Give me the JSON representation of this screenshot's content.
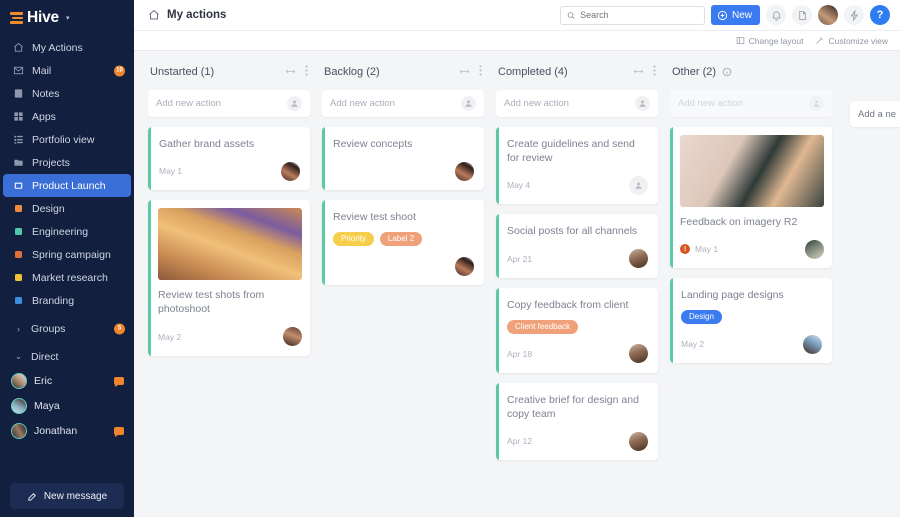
{
  "sidebar": {
    "logo": {
      "text": "Hive",
      "caret": "▾"
    },
    "nav": [
      {
        "label": "My Actions",
        "icon": "home-icon",
        "active": false
      },
      {
        "label": "Mail",
        "icon": "mail-icon",
        "active": false,
        "badge": "10"
      },
      {
        "label": "Notes",
        "icon": "notes-icon",
        "active": false
      },
      {
        "label": "Apps",
        "icon": "apps-grid-icon",
        "active": false
      },
      {
        "label": "Portfolio view",
        "icon": "list-icon",
        "active": false
      },
      {
        "label": "Projects",
        "icon": "folder-icon",
        "active": false
      },
      {
        "label": "Product Launch",
        "icon": "square-outline-icon",
        "active": true
      },
      {
        "label": "Design",
        "icon": "dot-icon",
        "dot": "#ef8a3c",
        "active": false
      },
      {
        "label": "Engineering",
        "icon": "dot-icon",
        "dot": "#52c8a9",
        "active": false
      },
      {
        "label": "Spring campaign",
        "icon": "dot-icon",
        "dot": "#e0703a",
        "active": false
      },
      {
        "label": "Market research",
        "icon": "dot-icon",
        "dot": "#f2c230",
        "active": false
      },
      {
        "label": "Branding",
        "icon": "dot-icon",
        "dot": "#3b8de0",
        "active": false
      }
    ],
    "groups": {
      "label": "Groups",
      "badge": "5",
      "chevron": "›"
    },
    "direct": {
      "label": "Direct",
      "chevron": "⌄"
    },
    "people": [
      {
        "name": "Eric",
        "unread": true
      },
      {
        "name": "Maya",
        "unread": false
      },
      {
        "name": "Jonathan",
        "unread": true
      }
    ],
    "new_message": "New message"
  },
  "topbar": {
    "title": "My actions",
    "home_icon": "home-icon",
    "search_placeholder": "Search",
    "search_value": "",
    "new_button": "New",
    "icons": [
      "bell-icon",
      "file-icon",
      "avatar",
      "lightning-icon",
      "help-icon"
    ],
    "help_glyph": "?"
  },
  "subbar": {
    "change_layout": "Change layout",
    "customize_view": "Customize view"
  },
  "board": {
    "add_column_label": "Add a ne",
    "add_new_action": "Add new action",
    "columns": [
      {
        "title": "Unstarted (1)",
        "has_info": false,
        "faded": false,
        "cards": [
          {
            "title": "Gather brand assets",
            "date": "May 1",
            "avatar": "woman-1",
            "labels": [],
            "image": null,
            "priority": false
          },
          {
            "title": "Review test shots from photoshoot",
            "date": "May 2",
            "avatar": "woman-2",
            "labels": [],
            "image": "sunglasses-pouch",
            "priority": false
          }
        ]
      },
      {
        "title": "Backlog (2)",
        "has_info": false,
        "faded": false,
        "cards": [
          {
            "title": "Review concepts",
            "date": "",
            "avatar": "woman-1",
            "labels": [],
            "image": null,
            "priority": false
          },
          {
            "title": "Review test shoot",
            "date": "",
            "avatar": "woman-1",
            "labels": [
              {
                "text": "Priority",
                "color": "#f7ce4b"
              },
              {
                "text": "Label 2",
                "color": "#f0a179"
              }
            ],
            "image": null,
            "priority": false
          }
        ]
      },
      {
        "title": "Completed (4)",
        "has_info": false,
        "faded": false,
        "cards": [
          {
            "title": "Create guidelines and send for review",
            "date": "May 4",
            "avatar": "placeholder",
            "labels": [],
            "image": null,
            "priority": false
          },
          {
            "title": "Social posts for all channels",
            "date": "Apr 21",
            "avatar": "woman-3",
            "labels": [],
            "image": null,
            "priority": false
          },
          {
            "title": "Copy feedback from client",
            "date": "Apr 18",
            "avatar": "woman-3",
            "labels": [
              {
                "text": "Client feedback",
                "color": "#f0a179"
              }
            ],
            "image": null,
            "priority": false
          },
          {
            "title": "Creative brief for design and copy team",
            "date": "Apr 12",
            "avatar": "woman-3",
            "labels": [],
            "image": null,
            "priority": false
          }
        ]
      },
      {
        "title": "Other (2)",
        "has_info": true,
        "faded": true,
        "cards": [
          {
            "title": "Feedback on imagery R2",
            "date": "May 1",
            "avatar": "woman-4",
            "labels": [],
            "image": "flatlay-sunglasses",
            "priority": true
          },
          {
            "title": "Landing page designs",
            "date": "May 2",
            "avatar": "woman-5",
            "labels": [
              {
                "text": "Design",
                "color": "#3b7bf0"
              }
            ],
            "image": null,
            "priority": false
          }
        ]
      }
    ]
  },
  "colors": {
    "sidebar_bg": "#131f3e",
    "accent_blue": "#3b7bf0",
    "accent_orange": "#f0852c",
    "card_accent_green": "#5ccaa6",
    "board_bg": "#f4f5f7"
  }
}
